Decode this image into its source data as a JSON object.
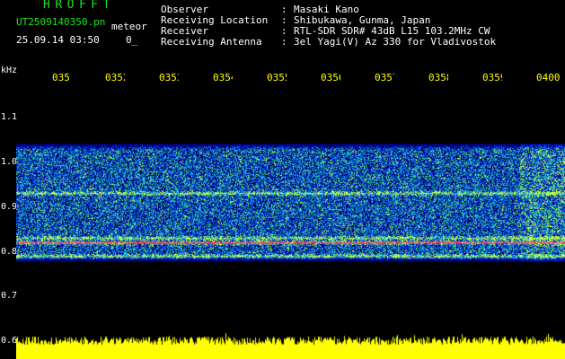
{
  "header": {
    "app_name": "HROFFT",
    "file_name": "UT2509140350.pn",
    "meteor_tag": "meteor",
    "datetime": "25.09.14 03:50",
    "counter": "0_",
    "info": [
      {
        "label": "Observer",
        "value": "Masaki Kano"
      },
      {
        "label": "Receiving Location",
        "value": "Shibukawa, Gunma, Japan"
      },
      {
        "label": "Receiver",
        "value": "RTL-SDR SDR# 43dB L15 103.2MHz CW"
      },
      {
        "label": "Receiving Antenna",
        "value": "3el Yagi(V) Az 330 for Vladivostok"
      }
    ]
  },
  "axes": {
    "freq_unit": "kHz",
    "time_ticks": [
      "035",
      "0352",
      "0353",
      "0354",
      "0355",
      "0356",
      "0357",
      "0358",
      "0359",
      "0400"
    ],
    "freq_ticks": [
      "1.1",
      "1.0",
      "0.9",
      "0.8",
      "0.7",
      "0.6"
    ]
  },
  "colors": {
    "title_green": "#19e619",
    "tick_yellow": "#ffff00",
    "noise_blue": "#1030c8",
    "signal_red": "#ff2060",
    "amplitude_yellow": "#ffff00"
  },
  "spectrogram": {
    "freq_range_khz": [
      0.78,
      1.04
    ],
    "signal_lines_khz": [
      0.93,
      0.83,
      0.82,
      0.79
    ],
    "strongest_line_khz": 0.82
  }
}
